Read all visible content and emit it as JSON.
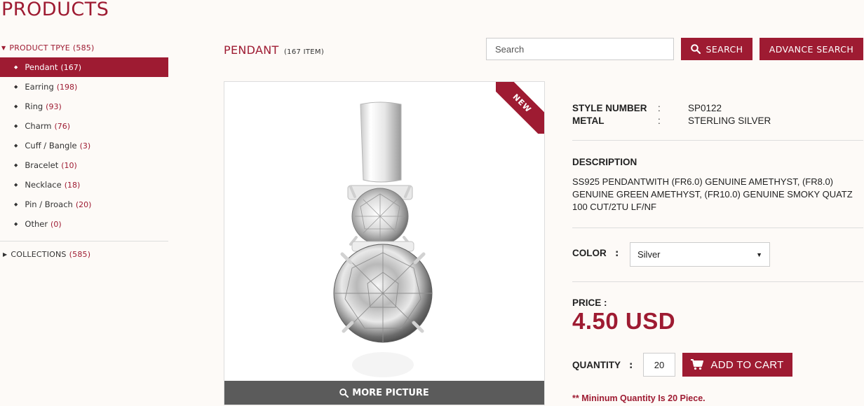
{
  "page": {
    "title": "PRODUCTS"
  },
  "sidebar": {
    "product_type": {
      "label": "PRODUCT TPYE",
      "count": "(585)"
    },
    "items": [
      {
        "label": "Pendant",
        "count": "(167)",
        "active": true
      },
      {
        "label": "Earring",
        "count": "(198)"
      },
      {
        "label": "Ring",
        "count": "(93)"
      },
      {
        "label": "Charm",
        "count": "(76)"
      },
      {
        "label": "Cuff / Bangle",
        "count": "(3)"
      },
      {
        "label": "Bracelet",
        "count": "(10)"
      },
      {
        "label": "Necklace",
        "count": "(18)"
      },
      {
        "label": "Pin / Broach",
        "count": "(20)"
      },
      {
        "label": "Other",
        "count": "(0)"
      }
    ],
    "collections": {
      "label": "COLLECTIONS",
      "count": "(585)"
    }
  },
  "category": {
    "title": "PENDANT",
    "item_count": "(167 ITEM)"
  },
  "search": {
    "placeholder": "Search",
    "button_label": "SEARCH",
    "advance_label": "ADVANCE SEARCH"
  },
  "product": {
    "badge": "NEW",
    "more_picture_label": "MORE PICTURE",
    "specs": [
      {
        "key": "STYLE NUMBER",
        "sep": ":",
        "value": "SP0122"
      },
      {
        "key": "METAL",
        "sep": ":",
        "value": "STERLING SILVER"
      }
    ],
    "description_label": "DESCRIPTION",
    "description": "SS925 PENDANTWITH (FR6.0) GENUINE AMETHYST, (FR8.0) GENUINE GREEN AMETHYST, (FR10.0) GENUINE SMOKY QUATZ 100 CUT/2TU LF/NF",
    "color_label": "COLOR",
    "color_sep": ":",
    "color_value": "Silver",
    "price_label": "PRICE :",
    "price": "4.50 USD",
    "quantity_label": "QUANTITY",
    "quantity_sep": ":",
    "quantity": "20",
    "add_to_cart_label": "ADD TO CART",
    "min_note": "** Mininum Quantity Is 20 Piece."
  },
  "colors": {
    "accent": "#9e1b32",
    "dark_bar": "#5b5b5b"
  }
}
